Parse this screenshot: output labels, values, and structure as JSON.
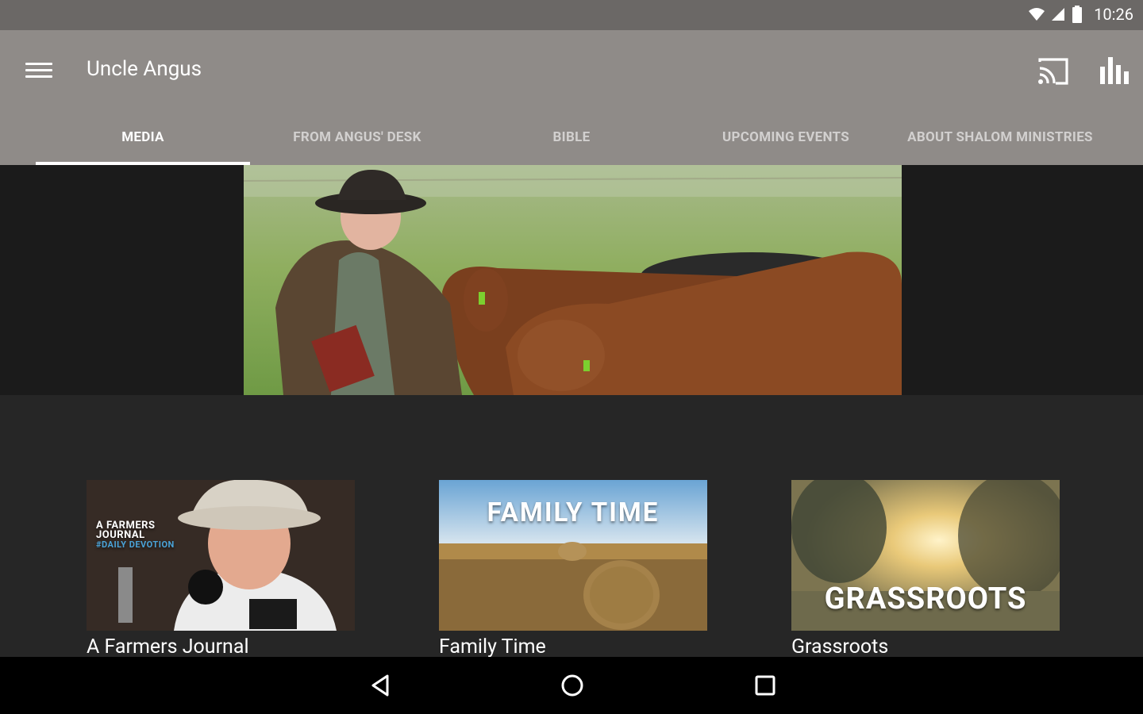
{
  "status_bar": {
    "time": "10:26"
  },
  "app_bar": {
    "title": "Uncle Angus",
    "icons": [
      "menu-icon",
      "cast-icon",
      "stats-icon"
    ]
  },
  "tabs": [
    {
      "label": "MEDIA",
      "active": true
    },
    {
      "label": "FROM ANGUS' DESK",
      "active": false
    },
    {
      "label": "BIBLE",
      "active": false
    },
    {
      "label": "UPCOMING EVENTS",
      "active": false
    },
    {
      "label": "ABOUT SHALOM MINISTRIES",
      "active": false
    }
  ],
  "cards": [
    {
      "label": "A Farmers Journal",
      "thumb_text_1": "A FARMERS",
      "thumb_text_2": "JOURNAL",
      "thumb_text_3": "#DAILY DEVOTION"
    },
    {
      "label": "Family Time",
      "thumb_text": "FAMILY TIME"
    },
    {
      "label": "Grassroots",
      "thumb_text": "GRASSROOTS"
    }
  ],
  "colors": {
    "status_bar": "#6b6866",
    "app_bar": "#8f8b88",
    "background": "#262626",
    "nav_bar": "#000000"
  }
}
